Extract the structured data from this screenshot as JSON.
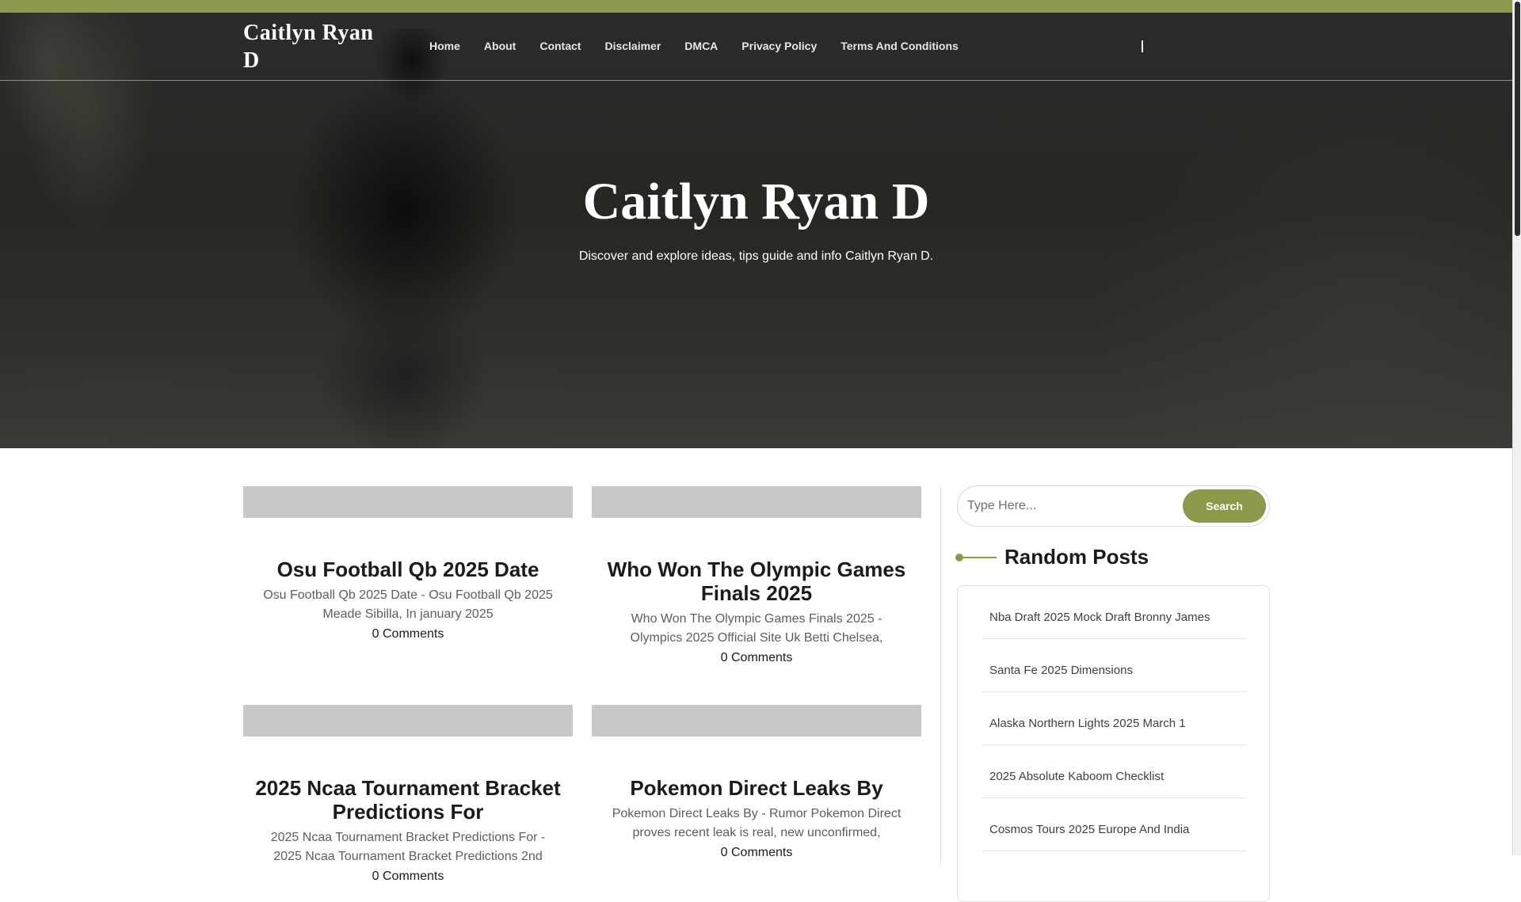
{
  "colors": {
    "accent": "#8a994a",
    "text_dark": "#1b1b1b",
    "placeholder_gray": "#c8c8c8"
  },
  "header": {
    "brand": "Caitlyn Ryan D",
    "nav": [
      "Home",
      "About",
      "Contact",
      "Disclaimer",
      "DMCA",
      "Privacy Policy",
      "Terms And Conditions"
    ]
  },
  "hero": {
    "title": "Caitlyn Ryan D",
    "subtitle": "Discover and explore ideas, tips guide and info Caitlyn Ryan D."
  },
  "posts": [
    {
      "title": "Osu Football Qb 2025 Date",
      "excerpt": "Osu Football Qb 2025 Date - Osu Football Qb 2025 Meade Sibilla, In january 2025",
      "comments": "0 Comments"
    },
    {
      "title": "Who Won The Olympic Games Finals 2025",
      "excerpt": "Who Won The Olympic Games Finals 2025 - Olympics 2025 Official Site Uk Betti Chelsea,",
      "comments": "0 Comments"
    },
    {
      "title": "2025 Ncaa Tournament Bracket Predictions For",
      "excerpt": "2025 Ncaa Tournament Bracket Predictions For - 2025 Ncaa Tournament Bracket Predictions 2nd",
      "comments": "0 Comments"
    },
    {
      "title": "Pokemon Direct Leaks By",
      "excerpt": "Pokemon Direct Leaks By - Rumor Pokemon Direct proves recent leak is real, new unconfirmed,",
      "comments": "0 Comments"
    }
  ],
  "sidebar": {
    "search": {
      "placeholder": "Type Here...",
      "button_label": "Search"
    },
    "random_posts_title": "Random Posts",
    "random_posts": [
      "Nba Draft 2025 Mock Draft Bronny James",
      "Santa Fe 2025 Dimensions",
      "Alaska Northern Lights 2025 March 1",
      "2025 Absolute Kaboom Checklist",
      "Cosmos Tours 2025 Europe And India"
    ]
  }
}
